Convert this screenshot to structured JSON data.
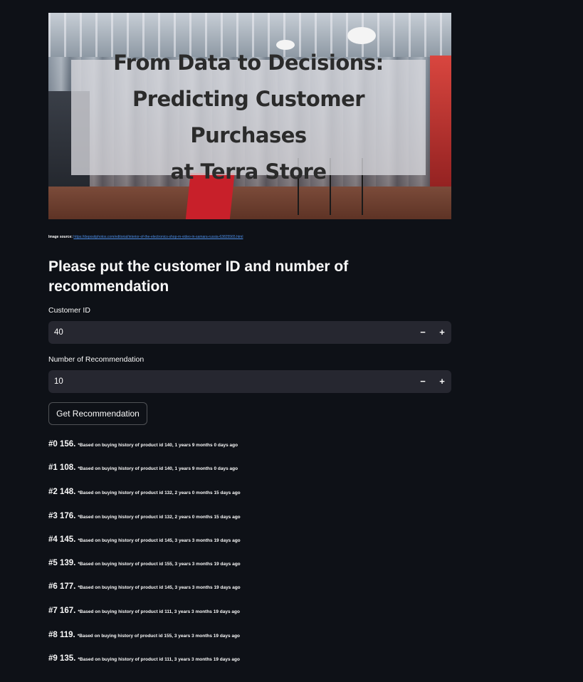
{
  "hero": {
    "title_lines": [
      "From Data to Decisions:",
      "Predicting Customer Purchases",
      "at Terra Store"
    ]
  },
  "source": {
    "label": "Image source:",
    "url": "https://depositphotos.com/editorial/interior-of-the-electronics-shop-m-video-in-samara-russia-63825565.html"
  },
  "heading": "Please put the customer ID and number of recommendation",
  "inputs": {
    "customer_id": {
      "label": "Customer ID",
      "value": "40",
      "minus": "−",
      "plus": "+"
    },
    "num_recommendation": {
      "label": "Number of Recommendation",
      "value": "10",
      "minus": "−",
      "plus": "+"
    }
  },
  "button": {
    "label": "Get Recommendation"
  },
  "recommendations": [
    {
      "rank": "#0 156.",
      "note": "*Based on buying history of product id 140, 1 years 9 months 0 days ago"
    },
    {
      "rank": "#1 108.",
      "note": "*Based on buying history of product id 140, 1 years 9 months 0 days ago"
    },
    {
      "rank": "#2 148.",
      "note": "*Based on buying history of product id 132, 2 years 0 months 15 days ago"
    },
    {
      "rank": "#3 176.",
      "note": "*Based on buying history of product id 132, 2 years 0 months 15 days ago"
    },
    {
      "rank": "#4 145.",
      "note": "*Based on buying history of product id 145, 3 years 3 months 19 days ago"
    },
    {
      "rank": "#5 139.",
      "note": "*Based on buying history of product id 155, 3 years 3 months 19 days ago"
    },
    {
      "rank": "#6 177.",
      "note": "*Based on buying history of product id 145, 3 years 3 months 19 days ago"
    },
    {
      "rank": "#7 167.",
      "note": "*Based on buying history of product id 111, 3 years 3 months 19 days ago"
    },
    {
      "rank": "#8 119.",
      "note": "*Based on buying history of product id 155, 3 years 3 months 19 days ago"
    },
    {
      "rank": "#9 135.",
      "note": "*Based on buying history of product id 111, 3 years 3 months 19 days ago"
    }
  ]
}
